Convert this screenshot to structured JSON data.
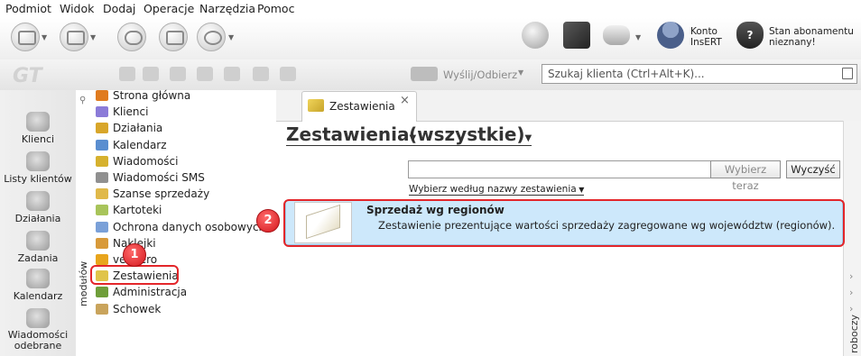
{
  "menu": [
    "Podmiot",
    "Widok",
    "Dodaj",
    "Operacje",
    "Narzędzia",
    "Pomoc"
  ],
  "toolbar": {
    "konto_line1": "Konto",
    "konto_line2": "InsERT",
    "abon_line1": "Stan abonamentu",
    "abon_line2": "nieznany!",
    "send_label": "Wyślij/Odbierz",
    "search_placeholder": "Szukaj klienta (Ctrl+Alt+K)..."
  },
  "rail": [
    "Klienci",
    "Listy klientów",
    "Działania",
    "Zadania",
    "Kalendarz",
    "Wiadomości odebrane"
  ],
  "modules": [
    {
      "label": "Strona główna",
      "color": "#e07b1f"
    },
    {
      "label": "Klienci",
      "color": "#8b7bd8"
    },
    {
      "label": "Działania",
      "color": "#d8a62a"
    },
    {
      "label": "Kalendarz",
      "color": "#5a8ed0"
    },
    {
      "label": "Wiadomości",
      "color": "#d6b12e"
    },
    {
      "label": "Wiadomości SMS",
      "color": "#909090"
    },
    {
      "label": "Szanse sprzedaży",
      "color": "#e0b94a"
    },
    {
      "label": "Kartoteki",
      "color": "#a8c45a"
    },
    {
      "label": "Ochrona danych osobowych",
      "color": "#7aa0d8"
    },
    {
      "label": "Naklejki",
      "color": "#d89a3a"
    },
    {
      "label": "vendero",
      "color": "#e8a51c"
    },
    {
      "label": "Zestawienia",
      "color": "#e0c44a"
    },
    {
      "label": "Administracja",
      "color": "#6f9e3a"
    },
    {
      "label": "Schowek",
      "color": "#c9a45c"
    }
  ],
  "modules_vertical": "modułów",
  "tab": {
    "label": "Zestawienia",
    "close": "×"
  },
  "header": {
    "title": "Zestawienia",
    "filter": "(wszystkie)"
  },
  "search": {
    "value": "",
    "choose_btn": "Wybierz teraz",
    "clear_btn": "Wyczyść",
    "hint": "Wybierz według nazwy zestawienia"
  },
  "report": {
    "title": "Sprzedaż wg regionów",
    "desc": "Zestawienie prezentujące wartości sprzedaży zagregowane wg województw (regionów)."
  },
  "right_vertical": "roboczy",
  "badges": [
    "1",
    "2"
  ],
  "colors": {
    "highlight": "#e3262a",
    "report_bg": "#cde8fb"
  }
}
